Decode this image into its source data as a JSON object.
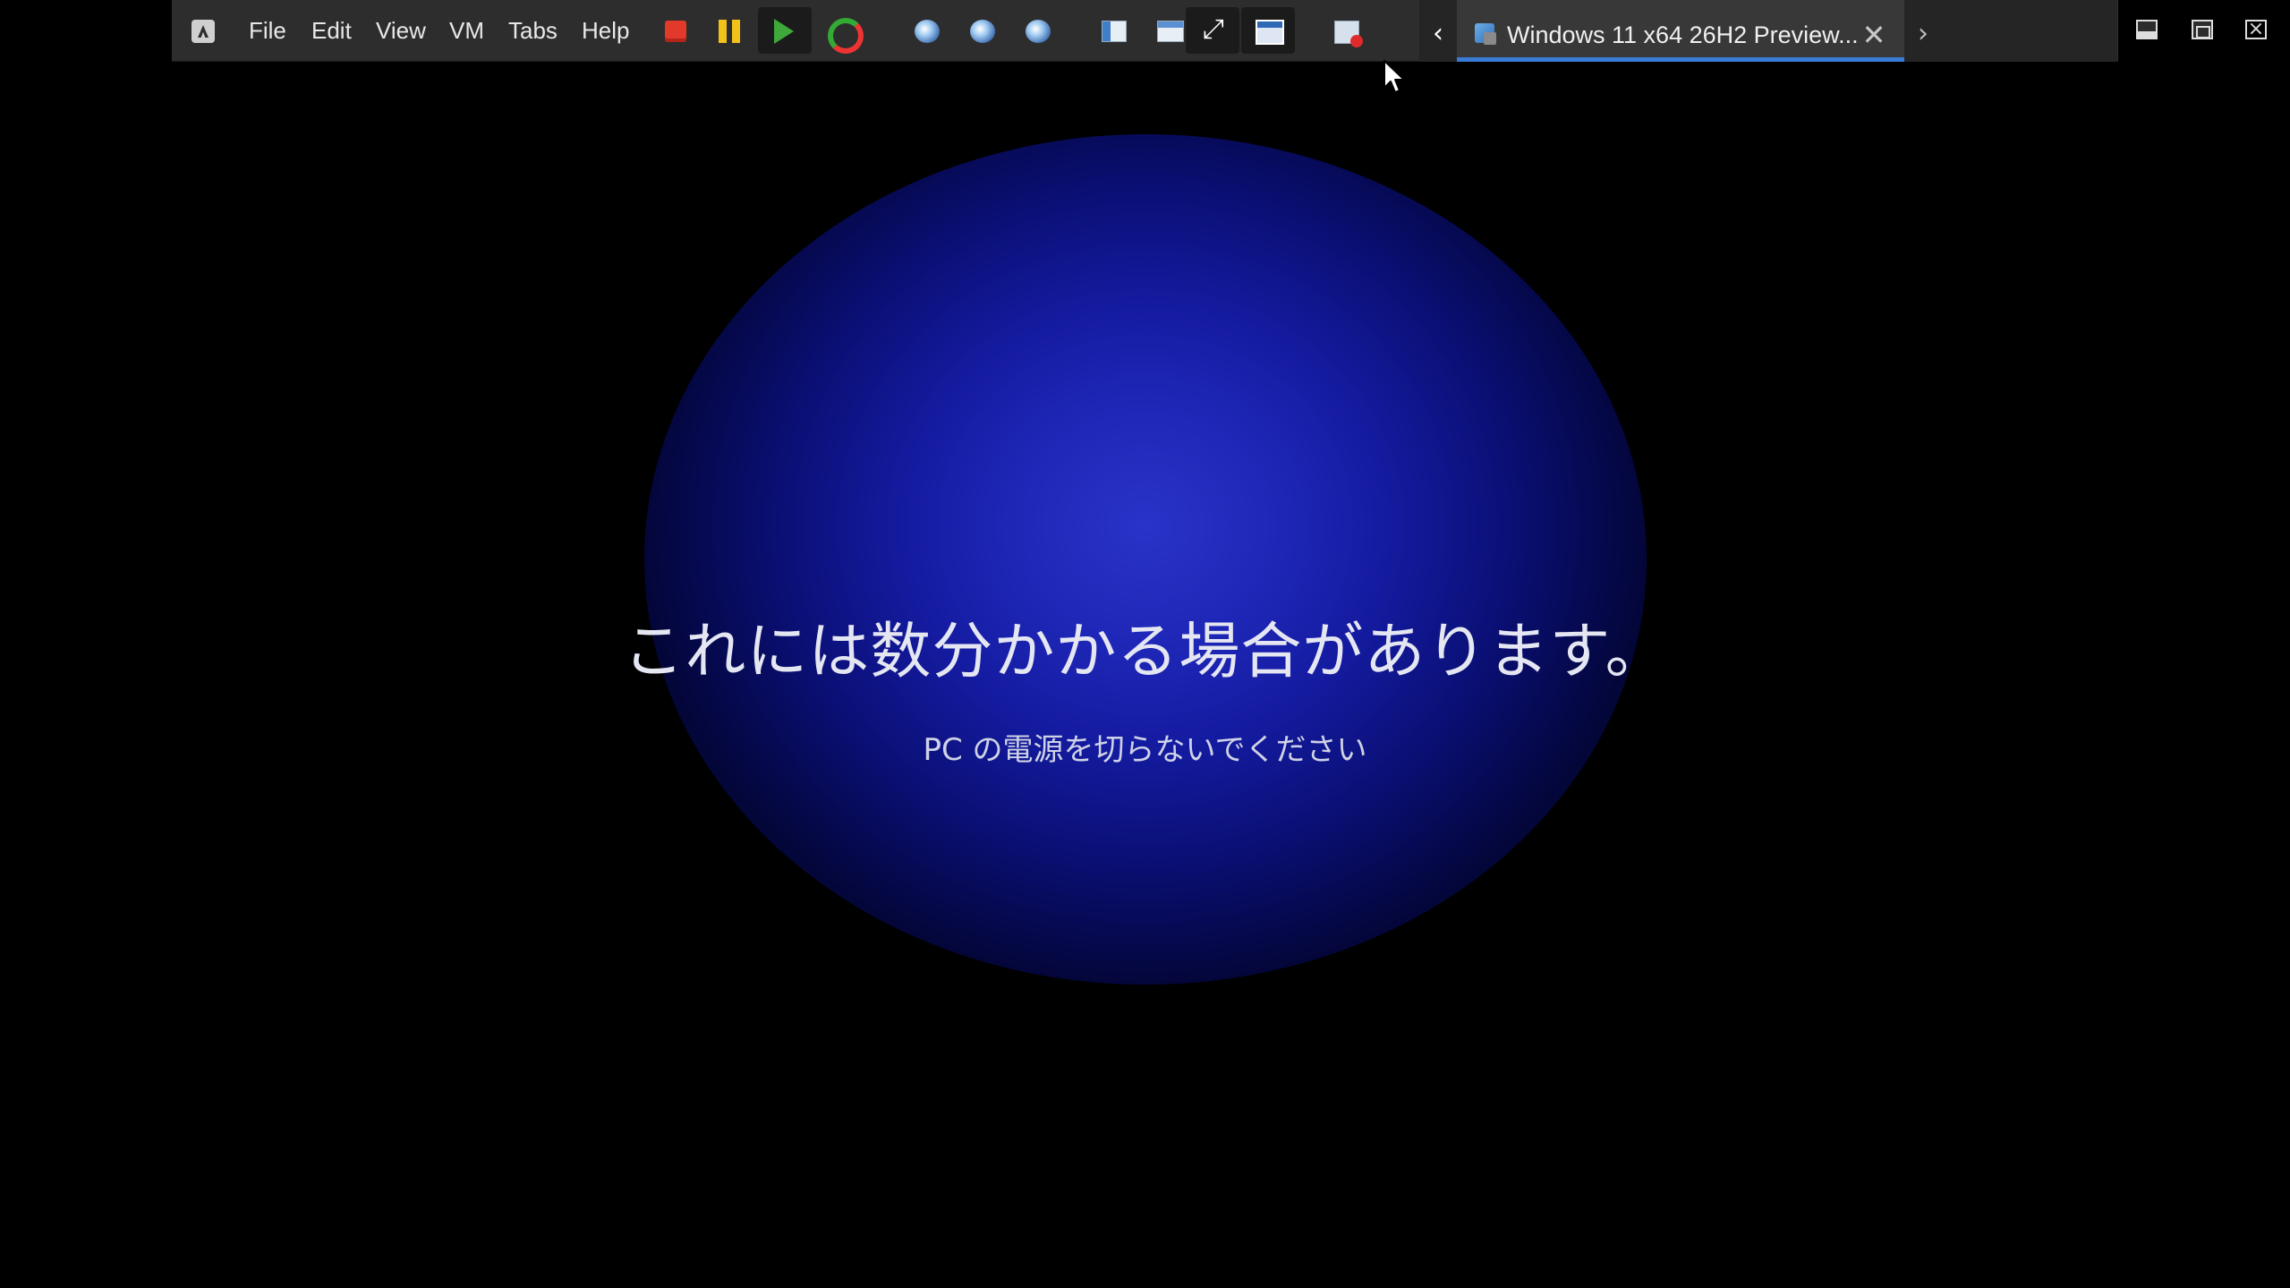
{
  "menu": {
    "file": "File",
    "edit": "Edit",
    "view": "View",
    "vm": "VM",
    "tabs": "Tabs",
    "help": "Help"
  },
  "toolbar_icons": [
    "app-icon",
    "stop-icon",
    "pause-icon",
    "play-icon",
    "reset-icon",
    "snapshot-take-icon",
    "snapshot-revert-icon",
    "snapshot-manager-icon",
    "sidebar-icon",
    "thumbnail-icon",
    "fullscreen-icon",
    "unity-icon",
    "console-icon"
  ],
  "tab": {
    "title": "Windows 11 x64 26H2 Preview...",
    "close_glyph": "✕",
    "prev_glyph": "‹",
    "next_glyph": "›"
  },
  "screen": {
    "main_message": "これには数分かかる場合があります。",
    "sub_message": "PC の電源を切らないでください"
  },
  "colors": {
    "toolbar_bg": "#2d2d2d",
    "tab_underline": "#3a7bd5",
    "glow_center": "#2a33c8",
    "text": "#e4e6f2"
  }
}
